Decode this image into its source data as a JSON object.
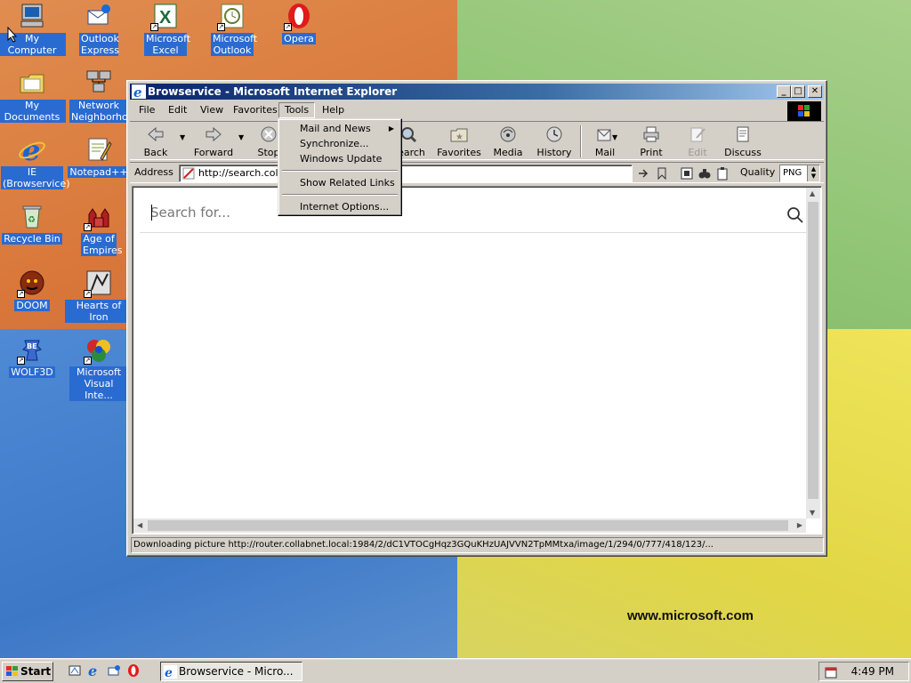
{
  "desktop": {
    "icons": [
      {
        "label": "My Computer"
      },
      {
        "label": "Outlook Express"
      },
      {
        "label": "Microsoft Excel"
      },
      {
        "label": "Microsoft Outlook"
      },
      {
        "label": "Opera"
      },
      {
        "label": "My Documents"
      },
      {
        "label": "Network Neighborhood"
      },
      {
        "label": "IE (Browservice)"
      },
      {
        "label": "Notepad++"
      },
      {
        "label": "Recycle Bin"
      },
      {
        "label": "Age of Empires"
      },
      {
        "label": "DOOM"
      },
      {
        "label": "Hearts of Iron"
      },
      {
        "label": "WOLF3D"
      },
      {
        "label": "Microsoft Visual Inte..."
      }
    ],
    "watermark": "www.microsoft.com"
  },
  "window": {
    "title": "Browservice - Microsoft Internet Explorer",
    "menu": [
      "File",
      "Edit",
      "View",
      "Favorites",
      "Tools",
      "Help"
    ],
    "active_menu": "Tools",
    "toolbar": {
      "back": "Back",
      "forward": "Forward",
      "stop": "Stop",
      "search": "Search",
      "favorites": "Favorites",
      "media": "Media",
      "history": "History",
      "mail": "Mail",
      "print": "Print",
      "edit": "Edit",
      "discuss": "Discuss"
    },
    "address": {
      "label": "Address",
      "url": "http://search.collabnet.local/"
    },
    "quality": {
      "label": "Quality",
      "value": "PNG"
    },
    "page": {
      "search_placeholder": "Search for..."
    },
    "status": "Downloading picture http://router.collabnet.local:1984/2/dC1VTOCgHqz3GQuKHzUAJVVN2TpMMtxa/image/1/294/0/777/418/123/..."
  },
  "tools_menu": {
    "items": [
      "Mail and News",
      "Synchronize...",
      "Windows Update",
      "Show Related Links",
      "Internet Options..."
    ]
  },
  "taskbar": {
    "start": "Start",
    "task": "Browservice - Micro...",
    "clock": "4:49 PM"
  }
}
